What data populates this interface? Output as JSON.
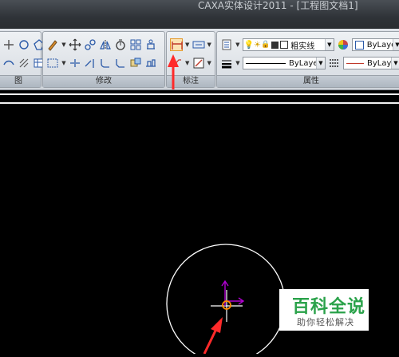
{
  "window": {
    "title": "CAXA实体设计2011 - [工程图文档1]"
  },
  "ribbon": {
    "groups": [
      {
        "label": "图"
      },
      {
        "label": "修改"
      },
      {
        "label": "标注"
      },
      {
        "label": "属性"
      }
    ],
    "properties": {
      "linetype": "粗实线",
      "color": "ByLayer",
      "line_style": "ByLayer",
      "line_color": "ByLayer"
    }
  },
  "watermark": {
    "title": "百科全说",
    "subtitle": "助你轻松解决"
  },
  "colors": {
    "annotation_arrow": "#ff2a2a",
    "axis_marker": "#b000d0",
    "point_marker": "#ff8c00",
    "watermark_green": "#2aa24a",
    "canvas_bg": "#000000"
  }
}
